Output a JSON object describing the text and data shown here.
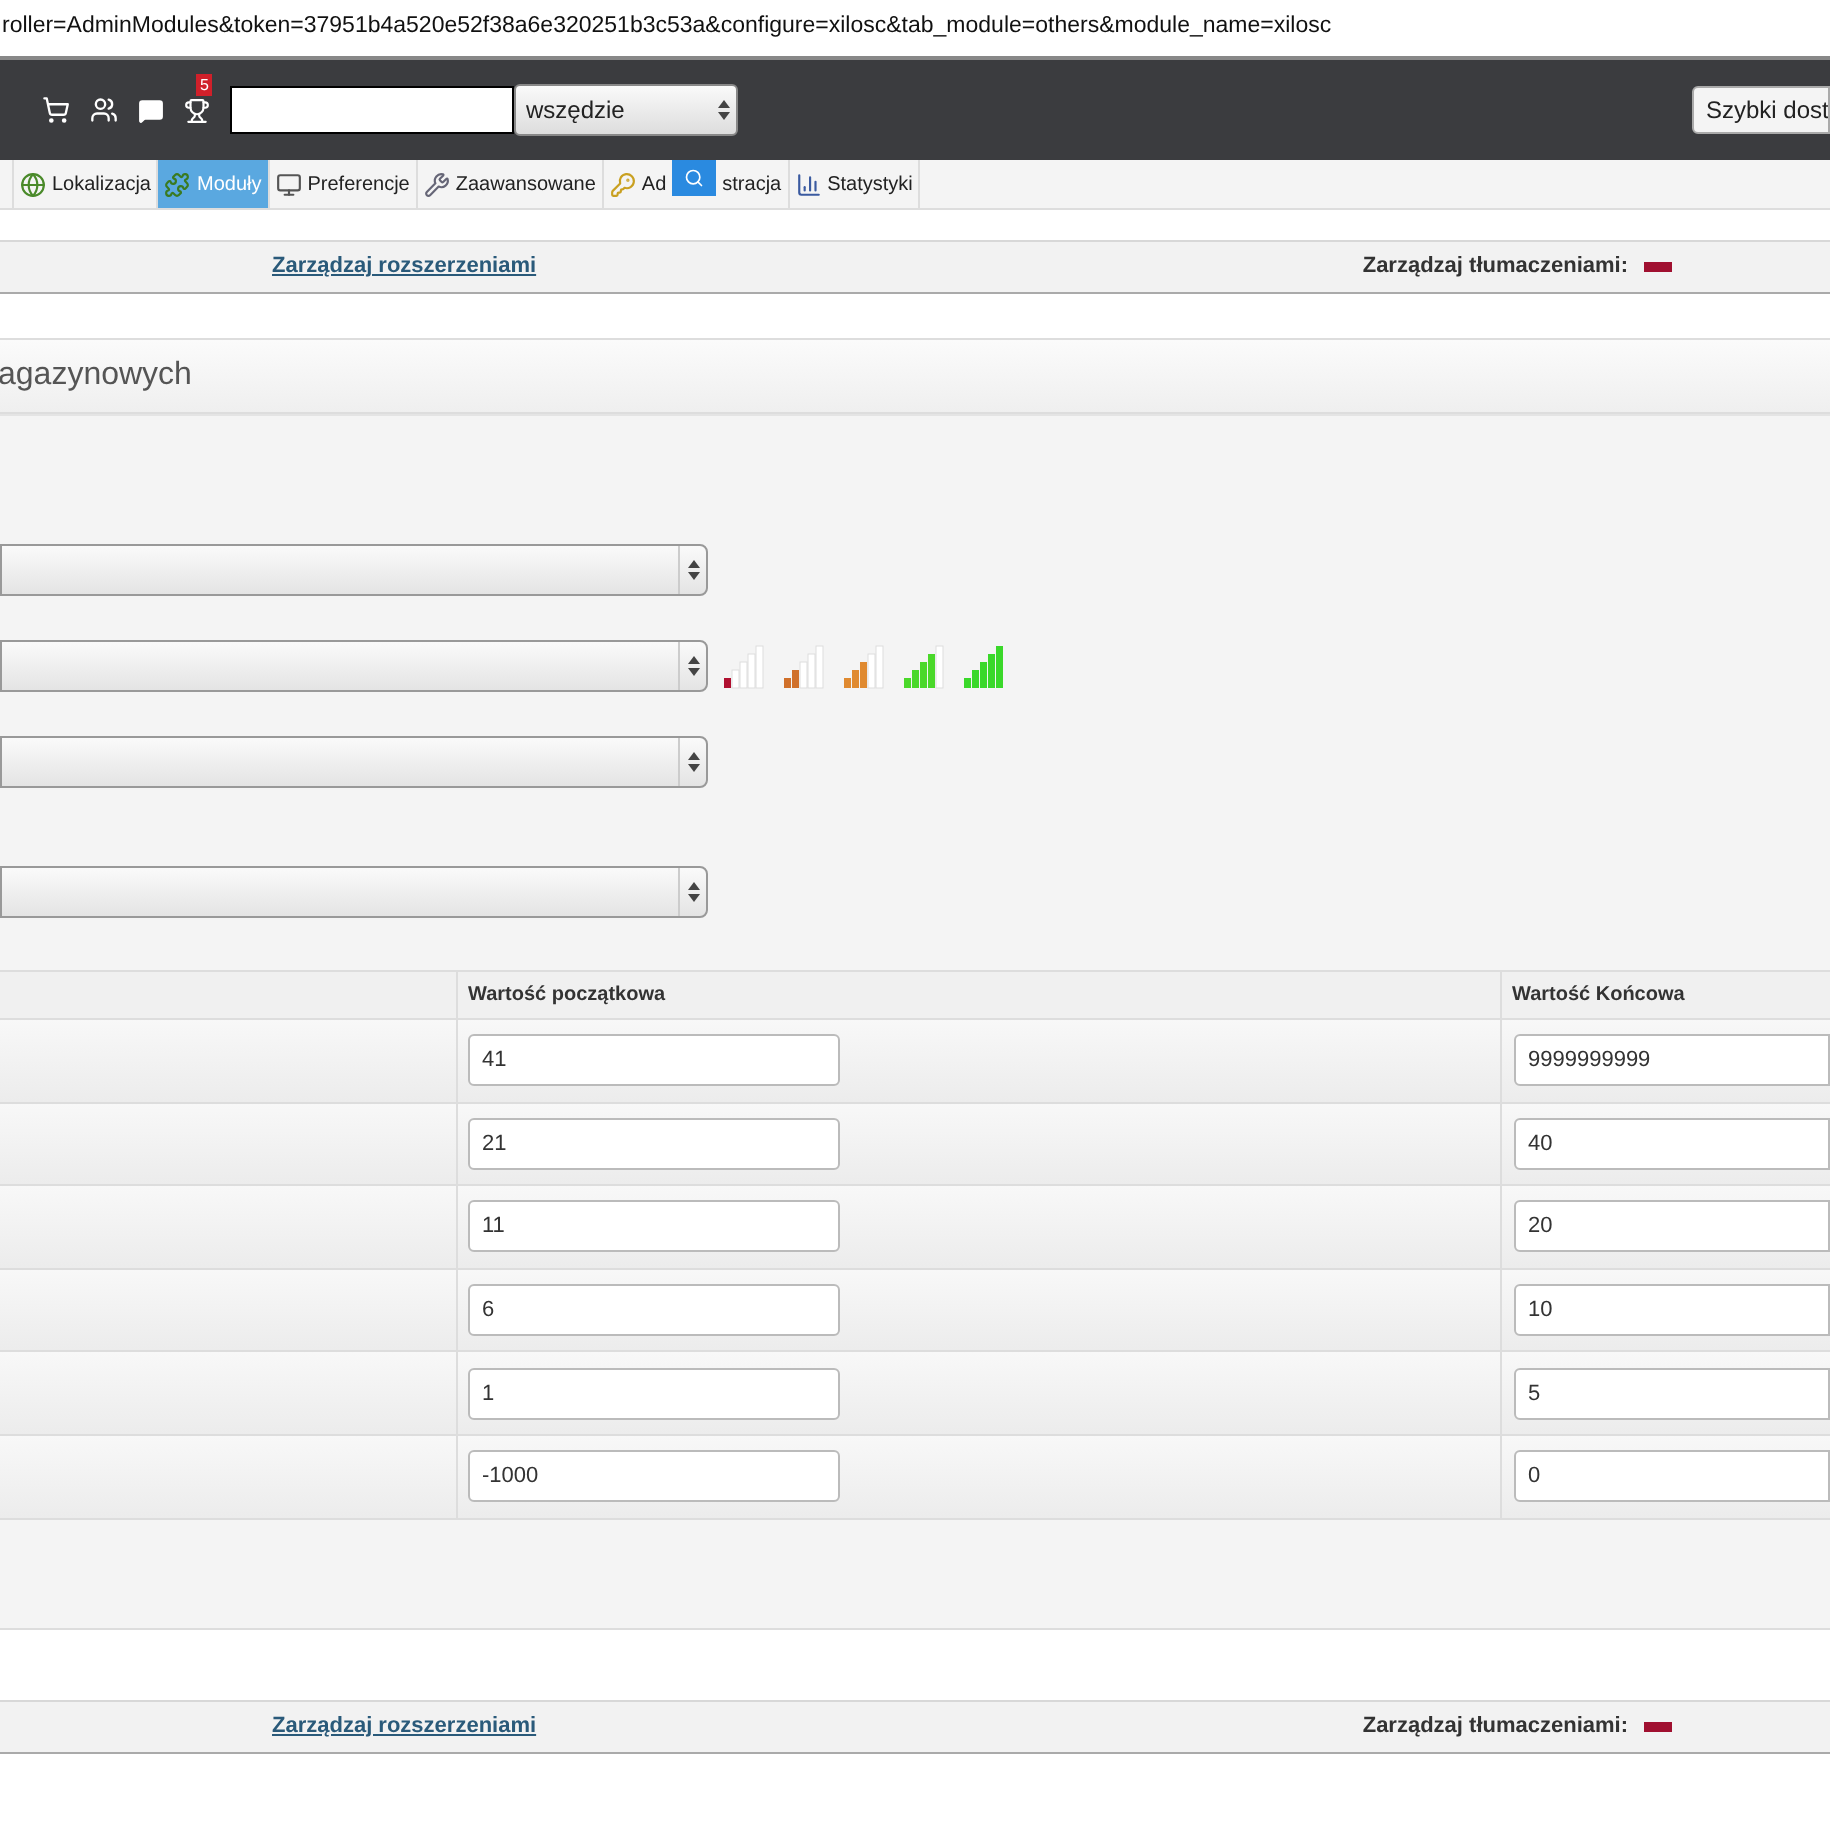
{
  "address_bar": {
    "url": "roller=AdminModules&token=37951b4a520e52f38a6e320251b3c53a&configure=xilosc&tab_module=others&module_name=xilosc"
  },
  "header": {
    "notification_badge": "5",
    "search_scope": "wszędzie",
    "quick_access": "Szybki dost"
  },
  "tabs": [
    {
      "kind": "globe",
      "label": "Lokalizacja",
      "selected": false
    },
    {
      "kind": "puzzle",
      "label": "Moduły",
      "selected": true
    },
    {
      "kind": "monitor",
      "label": "Preferencje",
      "selected": false
    },
    {
      "kind": "wrench",
      "label": "Zaawansowane",
      "selected": false
    },
    {
      "kind": "key",
      "label": "Ad",
      "label_after": "stracja",
      "selected": false
    },
    {
      "kind": "chart",
      "label": "Statystyki",
      "selected": false
    }
  ],
  "toolbar_top": {
    "link": "Zarządzaj rozszerzeniami",
    "translations": "Zarządzaj tłumaczeniami:"
  },
  "panel": {
    "title": "agazynowych"
  },
  "selects": [
    {
      "kind": "select"
    },
    {
      "kind": "select_with_legend"
    },
    {
      "kind": "select"
    },
    {
      "kind": "select"
    }
  ],
  "table": {
    "columns": [
      "Wartość początkowa",
      "Wartość Końcowa"
    ],
    "rows": [
      {
        "start": "41",
        "end": "9999999999"
      },
      {
        "start": "21",
        "end": "40"
      },
      {
        "start": "11",
        "end": "20"
      },
      {
        "start": "6",
        "end": "10"
      },
      {
        "start": "1",
        "end": "5"
      },
      {
        "start": "-1000",
        "end": "0"
      }
    ]
  },
  "toolbar_bottom": {
    "link": "Zarządzaj rozszerzeniami",
    "translations": "Zarządzaj tłumaczeniami:"
  }
}
